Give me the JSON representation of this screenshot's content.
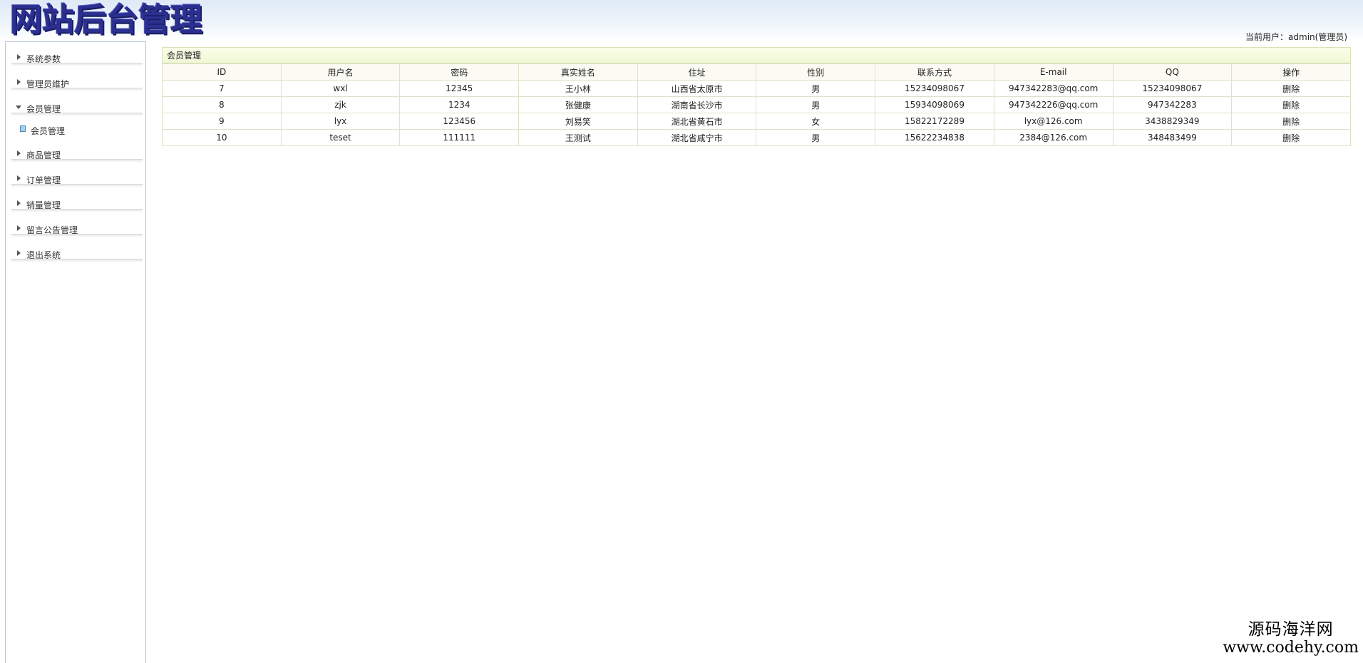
{
  "header": {
    "logo_text": "网站后台管理",
    "current_user": "当前用户：admin(管理员)"
  },
  "sidebar": {
    "items": [
      {
        "label": "系统参数",
        "expanded": false
      },
      {
        "label": "管理员维护",
        "expanded": false
      },
      {
        "label": "会员管理",
        "expanded": true,
        "children": [
          {
            "label": "会员管理"
          }
        ]
      },
      {
        "label": "商品管理",
        "expanded": false
      },
      {
        "label": "订单管理",
        "expanded": false
      },
      {
        "label": "销量管理",
        "expanded": false
      },
      {
        "label": "留言公告管理",
        "expanded": false
      },
      {
        "label": "退出系统",
        "expanded": false
      }
    ]
  },
  "panel": {
    "title": "会员管理"
  },
  "table": {
    "columns": [
      "ID",
      "用户名",
      "密码",
      "真实姓名",
      "住址",
      "性别",
      "联系方式",
      "E-mail",
      "QQ",
      "操作"
    ],
    "rows": [
      [
        "7",
        "wxl",
        "12345",
        "王小林",
        "山西省太原市",
        "男",
        "15234098067",
        "947342283@qq.com",
        "15234098067",
        "删除"
      ],
      [
        "8",
        "zjk",
        "1234",
        "张健康",
        "湖南省长沙市",
        "男",
        "15934098069",
        "947342226@qq.com",
        "947342283",
        "删除"
      ],
      [
        "9",
        "lyx",
        "123456",
        "刘易笑",
        "湖北省黄石市",
        "女",
        "15822172289",
        "lyx@126.com",
        "3438829349",
        "删除"
      ],
      [
        "10",
        "teset",
        "111111",
        "王测试",
        "湖北省咸宁市",
        "男",
        "15622234838",
        "2384@126.com",
        "348483499",
        "删除"
      ]
    ]
  },
  "watermark": {
    "line1": "源码海洋网",
    "line2": "www.codehy.com"
  }
}
